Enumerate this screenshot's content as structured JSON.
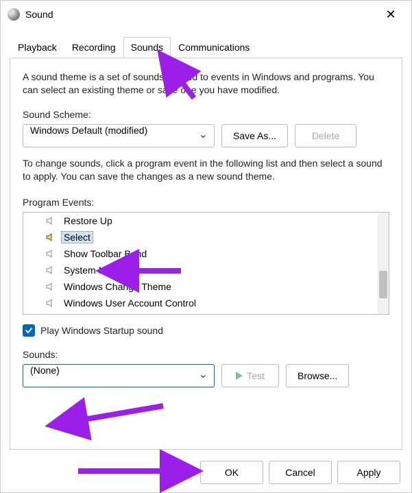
{
  "window": {
    "title": "Sound"
  },
  "tabs": {
    "items": [
      {
        "label": "Playback"
      },
      {
        "label": "Recording"
      },
      {
        "label": "Sounds"
      },
      {
        "label": "Communications"
      }
    ],
    "active_index": 2
  },
  "description": "A sound theme is a set of sounds applied to events in Windows and programs. You can select an existing theme or save one you have modified.",
  "scheme": {
    "label": "Sound Scheme:",
    "value": "Windows Default (modified)",
    "save_as_label": "Save As...",
    "delete_label": "Delete",
    "delete_enabled": false
  },
  "instruction": "To change sounds, click a program event in the following list and then select a sound to apply. You can save the changes as a new sound theme.",
  "events": {
    "label": "Program Events:",
    "items": [
      {
        "label": "Restore Up",
        "has_sound": false
      },
      {
        "label": "Select",
        "has_sound": true,
        "selected": true
      },
      {
        "label": "Show Toolbar Band",
        "has_sound": false
      },
      {
        "label": "System Notification",
        "has_sound": false
      },
      {
        "label": "Windows Change Theme",
        "has_sound": false
      },
      {
        "label": "Windows User Account Control",
        "has_sound": false
      }
    ]
  },
  "startup": {
    "checked": true,
    "label": "Play Windows Startup sound"
  },
  "sounds_select": {
    "label": "Sounds:",
    "value": "(None)",
    "test_label": "Test",
    "test_enabled": false,
    "browse_label": "Browse..."
  },
  "footer": {
    "ok": "OK",
    "cancel": "Cancel",
    "apply": "Apply"
  },
  "annotation_color": "#9b1fe8"
}
